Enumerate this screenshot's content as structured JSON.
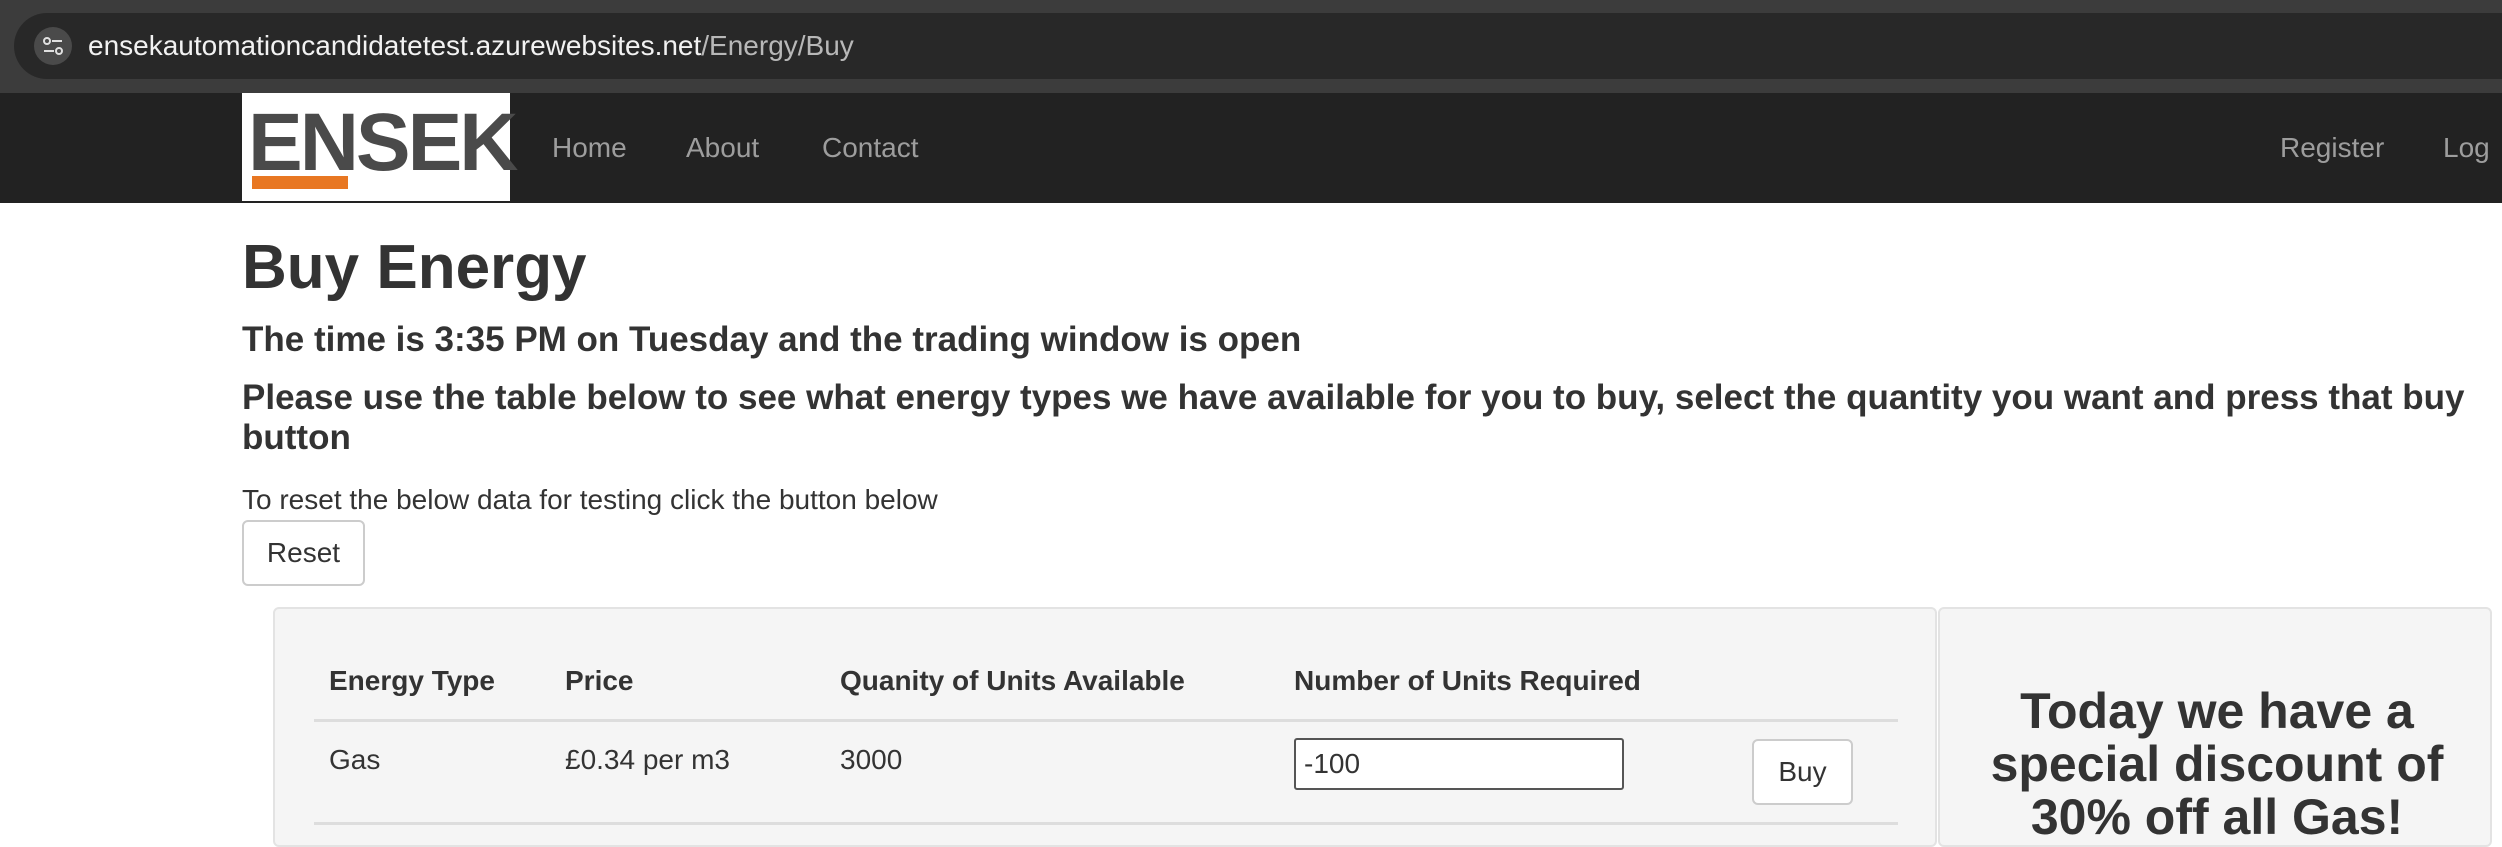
{
  "browser": {
    "url_domain": "ensekautomationcandidatetest.azurewebsites.net",
    "url_path": "/Energy/Buy"
  },
  "navbar": {
    "brand": "ENSEK",
    "links": [
      "Home",
      "About",
      "Contact"
    ],
    "right_links": [
      "Register",
      "Log"
    ]
  },
  "page": {
    "title": "Buy Energy",
    "time_message": "The time is 3:35 PM on Tuesday and the trading window is open",
    "instructions": "Please use the table below to see what energy types we have available for you to buy, select the quantity you want and press that buy button",
    "reset_text": "To reset the below data for testing click the button below",
    "reset_label": "Reset"
  },
  "table": {
    "headers": [
      "Energy Type",
      "Price",
      "Quanity of Units Available",
      "Number of Units Required"
    ],
    "rows": [
      {
        "energy_type": "Gas",
        "price": "£0.34 per m3",
        "available": "3000",
        "required": "-100",
        "buy_label": "Buy"
      }
    ]
  },
  "discount": {
    "text": "Today we have a special discount of 30% off all Gas!"
  }
}
